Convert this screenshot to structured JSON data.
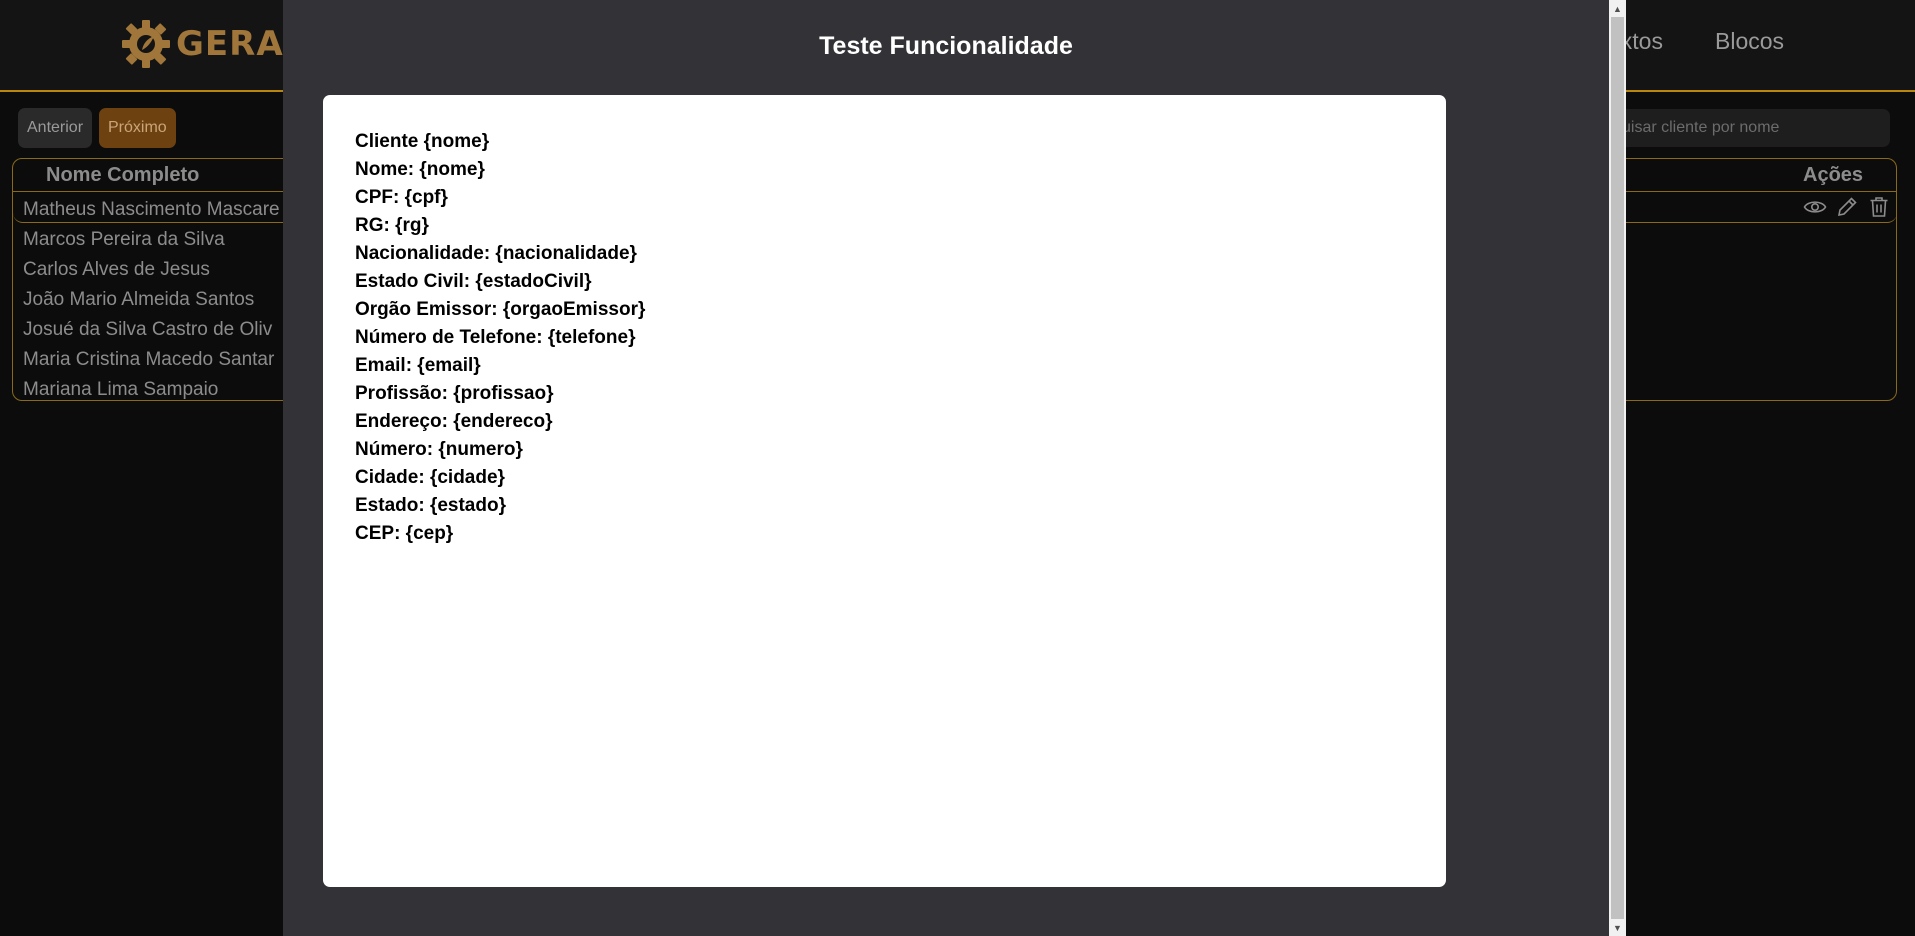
{
  "header": {
    "logo_text": "GERADO",
    "nav": [
      {
        "label": "extos"
      },
      {
        "label": "Blocos"
      }
    ]
  },
  "pagination": {
    "previous_label": "Anterior",
    "next_label": "Próximo"
  },
  "search": {
    "placeholder": "uisar cliente por nome"
  },
  "table": {
    "col_name": "Nome Completo",
    "col_actions": "Ações",
    "rows": [
      "Matheus Nascimento Mascare",
      "Marcos Pereira da Silva",
      "Carlos Alves de Jesus",
      "João Mario Almeida Santos",
      "Josué da Silva Castro de Oliv",
      "Maria Cristina Macedo Santar",
      "Mariana Lima Sampaio"
    ],
    "action_icons": [
      "eye-icon",
      "pencil-icon",
      "trash-icon"
    ]
  },
  "modal": {
    "title": "Teste Funcionalidade",
    "lines": [
      "Cliente {nome}",
      "Nome: {nome}",
      "CPF: {cpf}",
      "RG: {rg}",
      "Nacionalidade: {nacionalidade}",
      "Estado Civil: {estadoCivil}",
      "Orgão Emissor: {orgaoEmissor}",
      "Número de Telefone: {telefone}",
      "Email: {email}",
      "Profissão: {profissao}",
      "Endereço: {endereco}",
      "Número: {numero}",
      "Cidade: {cidade}",
      "Estado: {estado}",
      "CEP: {cep}"
    ]
  },
  "colors": {
    "accent": "#b8860b",
    "modal_bg": "#333237",
    "next_button_bg": "#6e4210"
  }
}
